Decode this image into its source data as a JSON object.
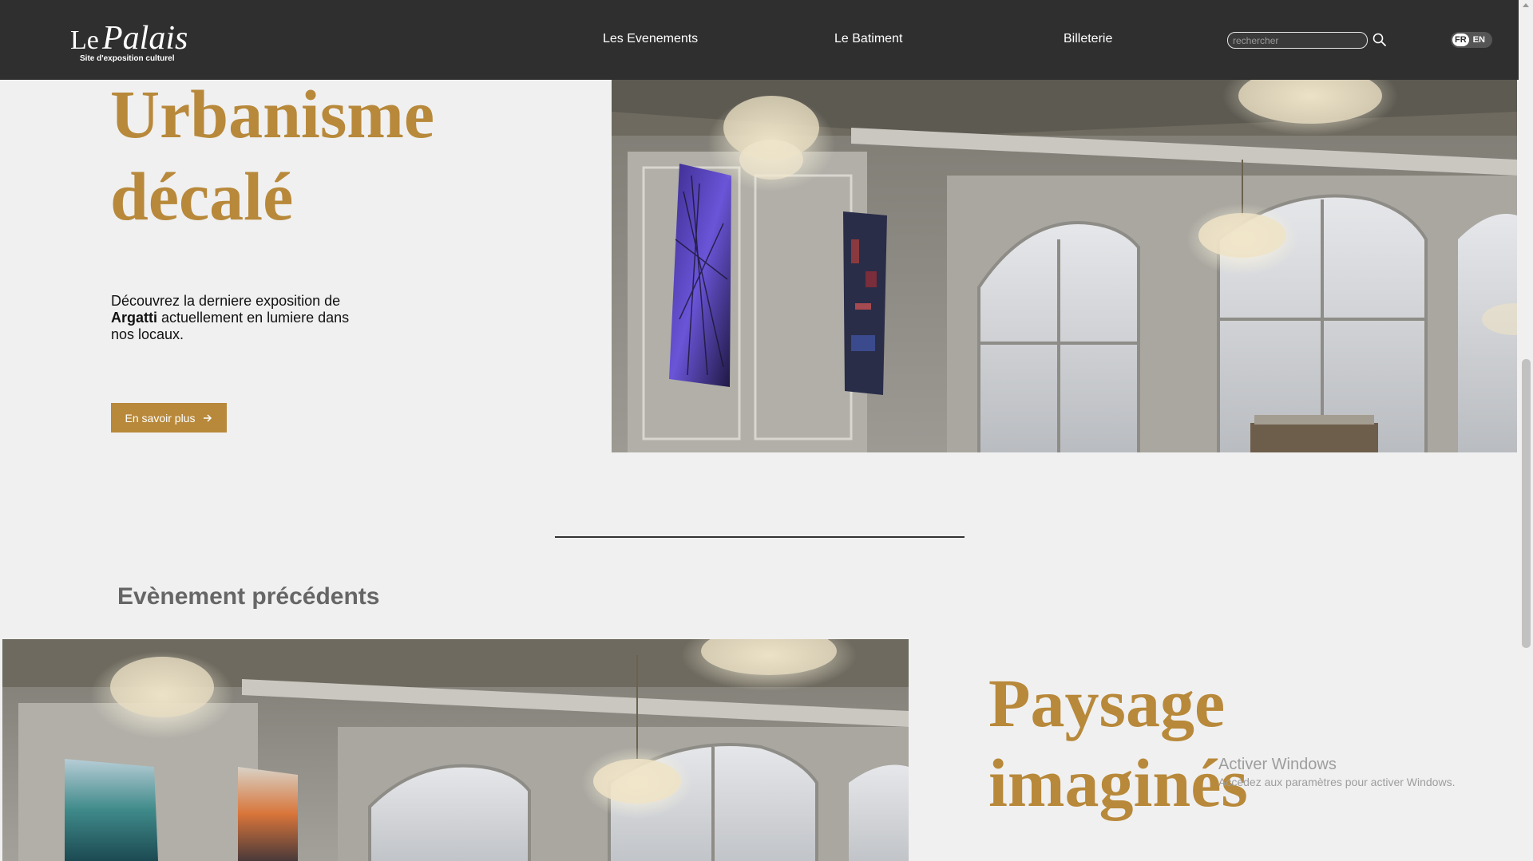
{
  "nav": {
    "logo_le": "Le",
    "logo_palais": "Palais",
    "logo_tagline": "Site d'exposition culturel",
    "links": [
      "Les Evenements",
      "Le Batiment",
      "Billeterie"
    ],
    "search_placeholder": "rechercher",
    "search_icon": "magnifier-icon",
    "lang_fr": "FR",
    "lang_en": "EN"
  },
  "hero": {
    "title_line1": "Urbanisme",
    "title_line2": "décalé",
    "desc_part1": "Découvrez la derniere exposition de",
    "desc_artist": "Argatti",
    "desc_part2": "actuellement en lumiere dans nos locaux.",
    "cta_label": "En savoir plus",
    "cta_icon": "arrow-right-icon"
  },
  "previous": {
    "section_title": "Evènement précédents",
    "title_line1": "Paysage",
    "title_line2": "imaginés"
  },
  "watermark": {
    "line1": "Activer Windows",
    "line2": "Accédez aux paramètres pour activer Windows."
  },
  "colors": {
    "nav_bg": "#2f2f2f",
    "accent_gold": "#b8893a",
    "page_bg": "#f0f0f0"
  }
}
